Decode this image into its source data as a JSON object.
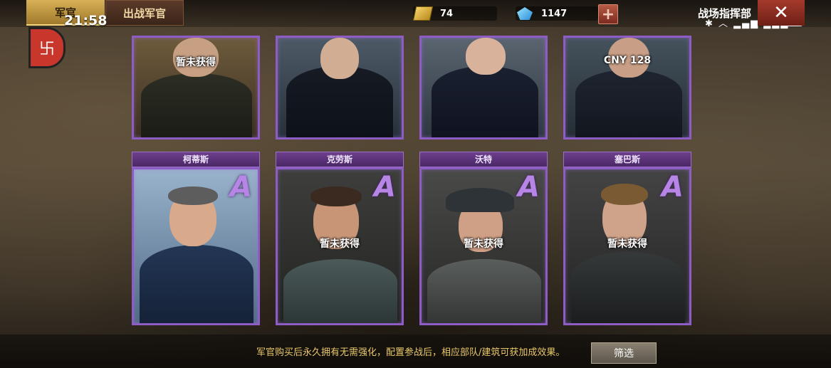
{
  "header": {
    "tab_active": "军官",
    "tab_inactive": "出战军官",
    "clock": "21:58",
    "gold": "74",
    "gems": "1147",
    "plus": "+",
    "hq_title": "战场指挥部",
    "battery": "25",
    "close": "✕"
  },
  "top_row": [
    {
      "status": "暂未获得"
    },
    {
      "status": ""
    },
    {
      "status": ""
    },
    {
      "status": "CNY 128"
    }
  ],
  "bottom_row": [
    {
      "name": "柯蒂斯",
      "grade": "A",
      "status": ""
    },
    {
      "name": "克劳斯",
      "grade": "A",
      "status": "暂未获得"
    },
    {
      "name": "沃特",
      "grade": "A",
      "status": "暂未获得"
    },
    {
      "name": "塞巴斯",
      "grade": "A",
      "status": "暂未获得"
    }
  ],
  "footer": {
    "hint": "军官购买后永久拥有无需强化，配置参战后，相应部队/建筑可获加成效果。",
    "filter_button": "筛选"
  },
  "colors": {
    "accent_gold": "#d8b056",
    "card_border": "#8d5cc5",
    "hint_text": "#e9c86b"
  }
}
